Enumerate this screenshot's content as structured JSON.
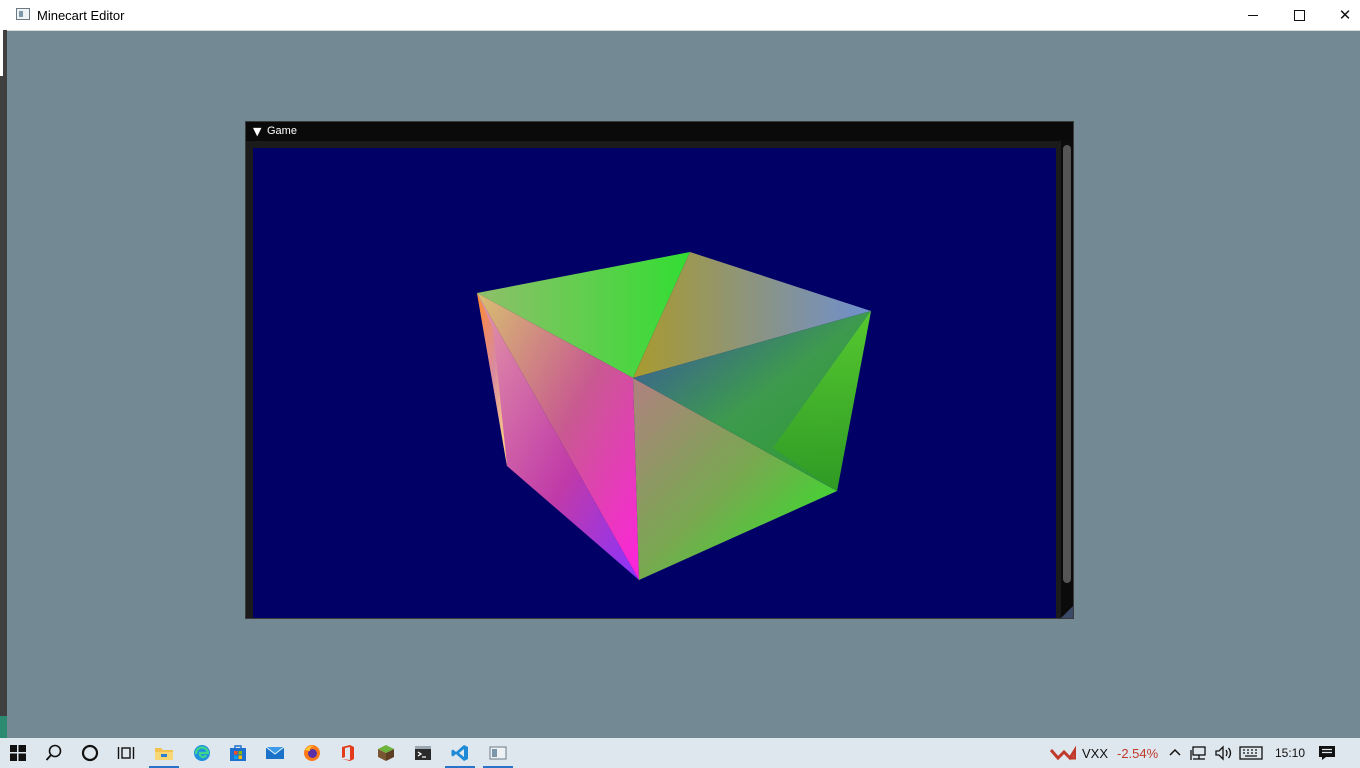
{
  "window": {
    "title": "Minecart Editor",
    "minimize_icon": "minimize-icon",
    "maximize_icon": "maximize-icon",
    "close_icon": "close-icon",
    "close_glyph": "✕"
  },
  "game_panel": {
    "title": "Game",
    "collapse_glyph": "▼",
    "viewport_background": "#000066"
  },
  "taskbar": {
    "apps": [
      {
        "name": "start-button",
        "icon": "windows-icon"
      },
      {
        "name": "search-button",
        "icon": "search-icon"
      },
      {
        "name": "cortana-button",
        "icon": "circle-icon"
      },
      {
        "name": "task-view-button",
        "icon": "task-view-icon"
      },
      {
        "name": "file-explorer-button",
        "icon": "folder-icon",
        "active": true
      },
      {
        "name": "edge-button",
        "icon": "edge-icon"
      },
      {
        "name": "store-button",
        "icon": "store-icon"
      },
      {
        "name": "mail-button",
        "icon": "mail-icon"
      },
      {
        "name": "firefox-button",
        "icon": "firefox-icon"
      },
      {
        "name": "office-button",
        "icon": "office-icon"
      },
      {
        "name": "minecraft-button",
        "icon": "grass-block-icon"
      },
      {
        "name": "terminal-button",
        "icon": "terminal-icon"
      },
      {
        "name": "vscode-button",
        "icon": "vscode-icon",
        "active": true
      },
      {
        "name": "minecart-editor-button",
        "icon": "app-window-icon",
        "active": true
      }
    ],
    "tray": {
      "ticker_symbol": "VXX",
      "ticker_change": "-2.54%",
      "ticker_color": "#c0392b",
      "time": "15:10"
    }
  }
}
